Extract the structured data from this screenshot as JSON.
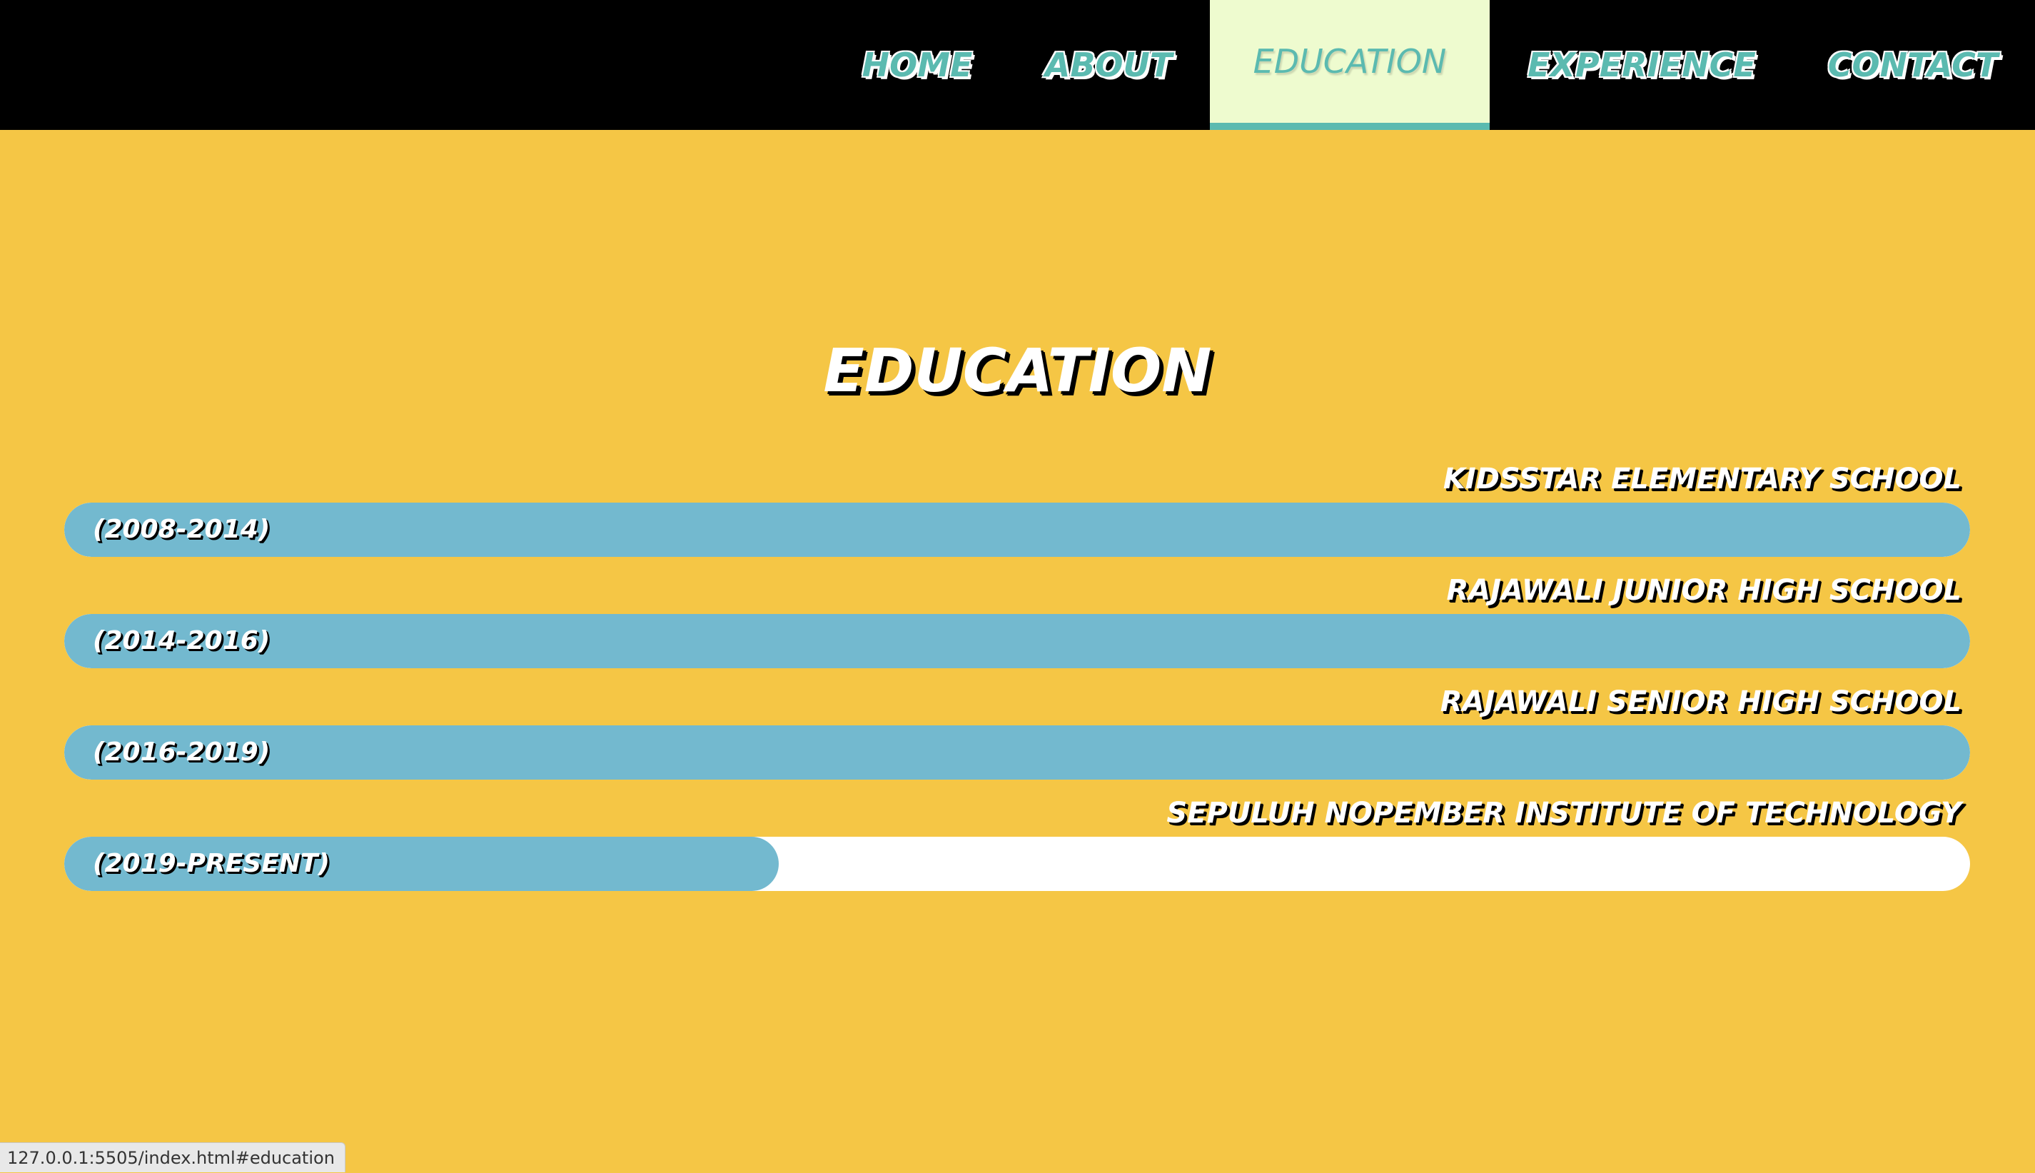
{
  "nav": {
    "items": [
      {
        "label": "HOME",
        "active": false
      },
      {
        "label": "ABOUT",
        "active": false
      },
      {
        "label": "EDUCATION",
        "active": true
      },
      {
        "label": "EXPERIENCE",
        "active": false
      },
      {
        "label": "CONTACT",
        "active": false
      }
    ]
  },
  "section": {
    "title": "EDUCATION"
  },
  "education": [
    {
      "school": "KIDSSTAR ELEMENTARY SCHOOL",
      "period": "(2008-2014)",
      "progress": 1.0
    },
    {
      "school": "RAJAWALI JUNIOR HIGH SCHOOL",
      "period": "(2014-2016)",
      "progress": 1.0
    },
    {
      "school": "RAJAWALI SENIOR HIGH SCHOOL",
      "period": "(2016-2019)",
      "progress": 1.0
    },
    {
      "school": "SEPULUH NOPEMBER INSTITUTE OF TECHNOLOGY",
      "period": "(2019-PRESENT)",
      "progress": 0.375
    }
  ],
  "status_bar": {
    "url": "127.0.0.1:5505/index.html#education"
  },
  "colors": {
    "background": "#f5c645",
    "navbar": "#000000",
    "accent_teal": "#5bbab0",
    "active_tab_bg": "#eefbcf",
    "bar_fill": "#73b9cf",
    "bar_track": "#ffffff"
  }
}
